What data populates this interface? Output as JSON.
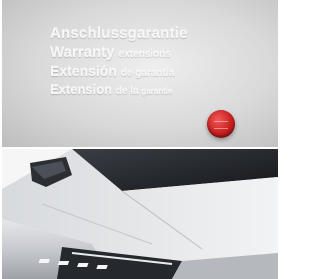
{
  "top_panel": {
    "lines": [
      {
        "main": "Anschlussgarantie"
      },
      {
        "main": "Warranty ",
        "small": "extensions"
      },
      {
        "main": "Extensión ",
        "small": "de garantía"
      },
      {
        "main": "Extension ",
        "small": "de la ",
        "tiny": "garantie"
      }
    ],
    "button_color": "#c91f1f"
  },
  "bottom_panel": {
    "body_color": "#c9ccd0",
    "headlight_color": "#2a2d33"
  }
}
